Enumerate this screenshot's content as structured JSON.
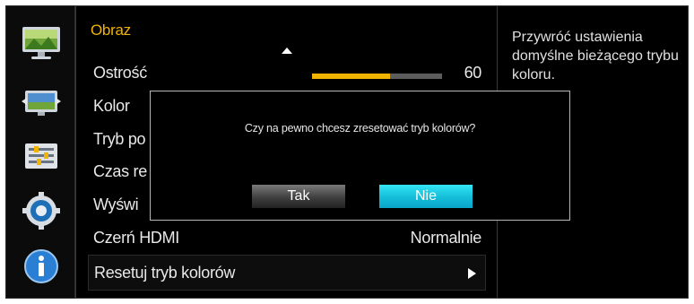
{
  "menu": {
    "title": "Obraz",
    "items": [
      {
        "label": "Ostrość",
        "value": "60",
        "level": 0.6
      },
      {
        "label": "Kolor",
        "value": ""
      },
      {
        "label": "Tryb po",
        "value": ""
      },
      {
        "label": "Czas re",
        "value": ""
      },
      {
        "label": "Wyświ",
        "value": ""
      },
      {
        "label": "Czerń HDMI",
        "value": "Normalnie"
      },
      {
        "label": "Resetuj tryb kolorów",
        "value": ""
      }
    ]
  },
  "help": {
    "text": "Przywróć ustawienia domyślne bieżącego trybu koloru."
  },
  "dialog": {
    "question": "Czy na pewno chcesz zresetować tryb kolorów?",
    "yes_label": "Tak",
    "no_label": "Nie"
  },
  "icons": [
    "picture-icon",
    "screen-size-icon",
    "settings-list-icon",
    "gear-icon",
    "info-icon"
  ],
  "colors": {
    "accent": "#f0b400",
    "selected_button": "#14bcd8"
  }
}
